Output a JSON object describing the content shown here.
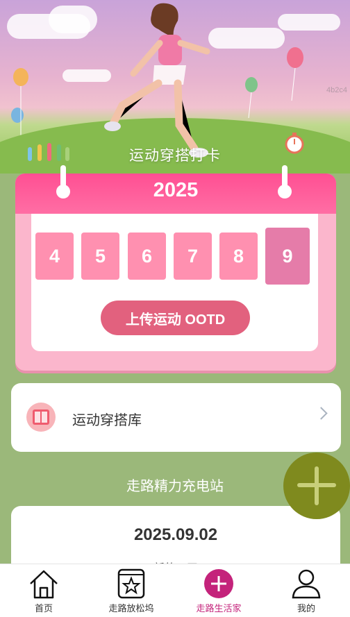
{
  "hero": {
    "title": "运动穿搭打卡",
    "watermark": "4b2c4"
  },
  "calendar": {
    "year": "2025",
    "days": [
      "4",
      "5",
      "6",
      "7",
      "8",
      "9"
    ],
    "selected_day": "9",
    "upload_label": "上传运动 OOTD"
  },
  "library": {
    "label": "运动穿搭库"
  },
  "section": {
    "title": "走路精力充电站"
  },
  "daily": {
    "date": "2025.09.02",
    "subtitle": "新的一天"
  },
  "fab": {
    "icon": "plus-icon"
  },
  "tabs": [
    {
      "label": "首页",
      "icon": "home-icon"
    },
    {
      "label": "走路放松坞",
      "icon": "star-book-icon"
    },
    {
      "label": "走路生活家",
      "icon": "plus-circle-icon",
      "active": true
    },
    {
      "label": "我的",
      "icon": "user-icon"
    }
  ],
  "colors": {
    "accent": "#c4237b",
    "calendar": "#ff4f93",
    "day": "#ff90b0",
    "fab": "#7f8a1e"
  }
}
